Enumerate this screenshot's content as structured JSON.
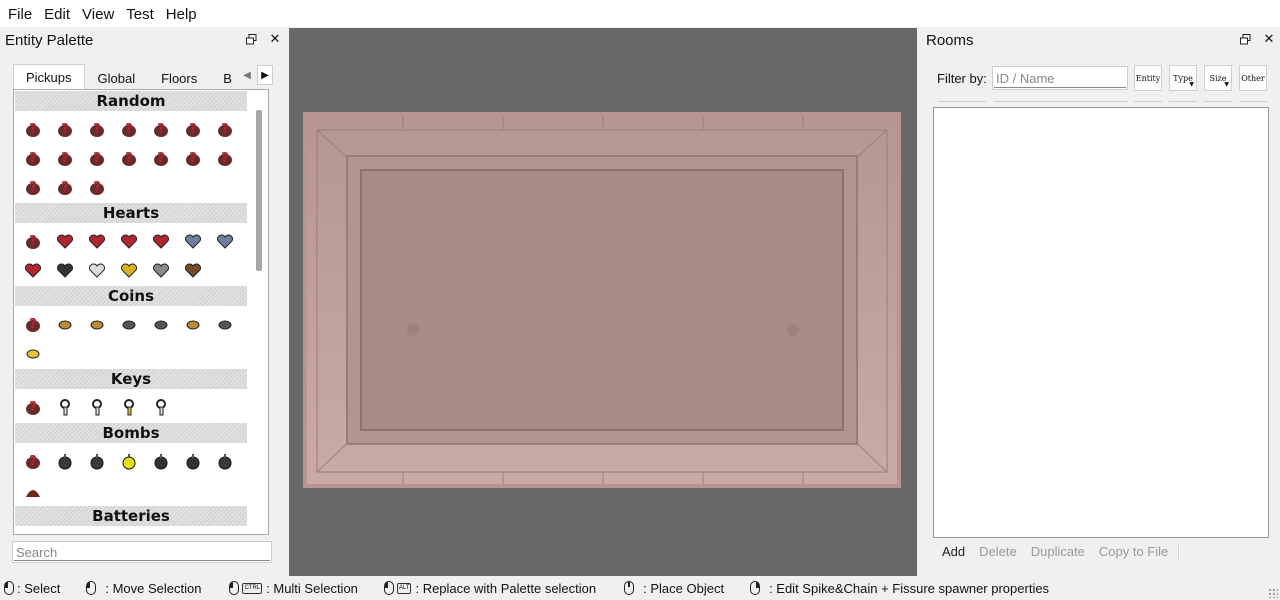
{
  "menu": [
    "File",
    "Edit",
    "View",
    "Test",
    "Help"
  ],
  "entity_palette": {
    "title": "Entity Palette",
    "tabs": [
      "Pickups",
      "Global",
      "Floors",
      "B"
    ],
    "sections": [
      {
        "title": "Random",
        "icons": [
          "random-pickup-icon",
          "random-heart-icon",
          "random-key-icon",
          "random-coin-icon",
          "random-bomb-icon",
          "random-heart-2-icon",
          "random-chest-icon",
          "random-multi-icon",
          "random-heart-3-icon",
          "random-coin-2-icon",
          "random-key-2-icon",
          "random-bomb-2-icon",
          "random-card-icon",
          "random-pill-icon",
          "random-sack-icon",
          "random-heart-4-icon",
          "random-coin-bag-icon"
        ]
      },
      {
        "title": "Hearts",
        "icons": [
          "heart-random-icon",
          "red-heart-icon",
          "half-heart-icon",
          "double-heart-icon",
          "scared-heart-icon",
          "soul-heart-icon",
          "half-soul-heart-icon",
          "blended-heart-icon",
          "black-heart-icon",
          "eternal-heart-icon",
          "gold-heart-icon",
          "bone-heart-icon",
          "rotten-heart-icon"
        ]
      },
      {
        "title": "Coins",
        "icons": [
          "coin-random-icon",
          "penny-icon",
          "double-penny-icon",
          "nickel-icon",
          "dime-icon",
          "lucky-penny-icon",
          "sticky-nickel-icon",
          "golden-penny-icon"
        ]
      },
      {
        "title": "Keys",
        "icons": [
          "key-random-icon",
          "key-icon",
          "double-key-icon",
          "golden-key-icon",
          "charged-key-icon"
        ]
      },
      {
        "title": "Bombs",
        "icons": [
          "bomb-random-icon",
          "bomb-icon",
          "double-bomb-icon",
          "golden-bomb-icon",
          "troll-bomb-icon",
          "mega-troll-bomb-icon",
          "giga-bomb-icon",
          "poop-icon"
        ]
      },
      {
        "title": "Batteries",
        "icons": []
      }
    ],
    "search_placeholder": "Search"
  },
  "rooms_panel": {
    "title": "Rooms",
    "filter_label": "Filter by:",
    "filter_placeholder": "ID / Name",
    "filter_buttons": [
      "Entity",
      "Type",
      "Size",
      "Other"
    ],
    "actions": [
      "Add",
      "Delete",
      "Duplicate",
      "Copy to File"
    ]
  },
  "status_hints": [
    {
      "mouse": "left",
      "key": "",
      "text": ": Select"
    },
    {
      "mouse": "left",
      "key": "",
      "text": ": Move Selection"
    },
    {
      "mouse": "left",
      "key": "CTRL",
      "text": ": Multi Selection"
    },
    {
      "mouse": "left",
      "key": "ALT",
      "text": ": Replace with Palette selection"
    },
    {
      "mouse": "mid",
      "key": "",
      "text": ": Place Object"
    },
    {
      "mouse": "right",
      "key": "",
      "text": ": Edit Spike&Chain + Fissure spawner properties"
    }
  ],
  "colors": {
    "room_floor": "#a98a86",
    "room_wall": "#c7a8a2",
    "viewport_bg": "#686868",
    "pickup_red": "#b22630"
  }
}
